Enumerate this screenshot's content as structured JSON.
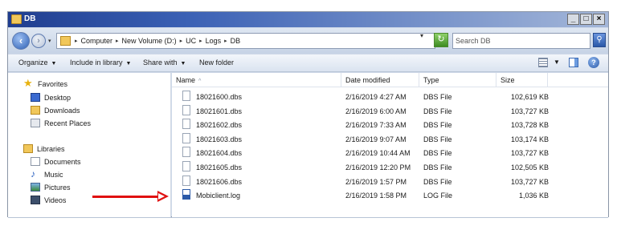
{
  "window": {
    "title": "DB",
    "controls": [
      "_",
      "□",
      "×"
    ]
  },
  "address": {
    "crumbs": [
      "Computer",
      "New Volume (D:)",
      "UC",
      "Logs",
      "DB"
    ],
    "search_placeholder": "Search DB"
  },
  "toolbar": {
    "organize": "Organize",
    "include_in_library": "Include in library",
    "share_with": "Share with",
    "new_folder": "New folder"
  },
  "nav": {
    "favorites": "Favorites",
    "desktop": "Desktop",
    "downloads": "Downloads",
    "recent_places": "Recent Places",
    "libraries": "Libraries",
    "documents": "Documents",
    "music": "Music",
    "pictures": "Pictures",
    "videos": "Videos"
  },
  "columns": {
    "name": "Name",
    "date": "Date modified",
    "type": "Type",
    "size": "Size"
  },
  "files": [
    {
      "name": "18021600.dbs",
      "date": "2/16/2019 4:27 AM",
      "type": "DBS File",
      "size": "102,619 KB",
      "icon": "document-icon"
    },
    {
      "name": "18021601.dbs",
      "date": "2/16/2019 6:00 AM",
      "type": "DBS File",
      "size": "103,727 KB",
      "icon": "document-icon"
    },
    {
      "name": "18021602.dbs",
      "date": "2/16/2019 7:33 AM",
      "type": "DBS File",
      "size": "103,728 KB",
      "icon": "document-icon"
    },
    {
      "name": "18021603.dbs",
      "date": "2/16/2019 9:07 AM",
      "type": "DBS File",
      "size": "103,174 KB",
      "icon": "document-icon"
    },
    {
      "name": "18021604.dbs",
      "date": "2/16/2019 10:44 AM",
      "type": "DBS File",
      "size": "103,727 KB",
      "icon": "document-icon"
    },
    {
      "name": "18021605.dbs",
      "date": "2/16/2019 12:20 PM",
      "type": "DBS File",
      "size": "102,505 KB",
      "icon": "document-icon"
    },
    {
      "name": "18021606.dbs",
      "date": "2/16/2019 1:57 PM",
      "type": "DBS File",
      "size": "103,727 KB",
      "icon": "document-icon"
    },
    {
      "name": "Mobiclient.log",
      "date": "2/16/2019 1:58 PM",
      "type": "LOG File",
      "size": "1,036 KB",
      "icon": "log-file-icon"
    }
  ],
  "colors": {
    "annotation_arrow": "#e01010",
    "titlebar": "#1f3d8f"
  }
}
